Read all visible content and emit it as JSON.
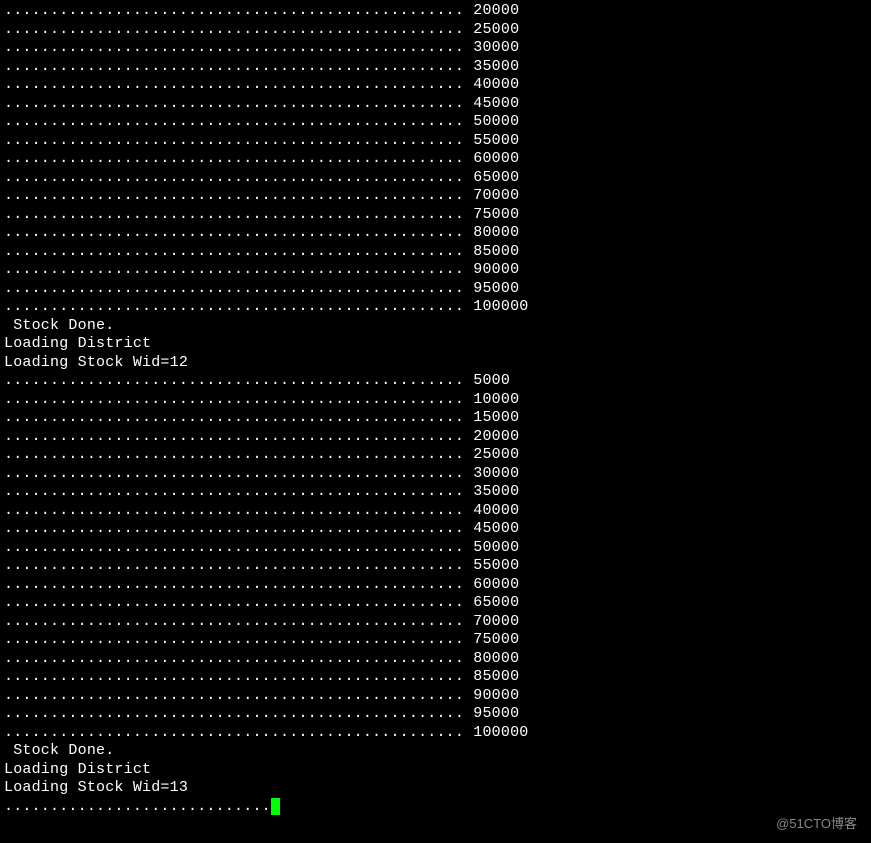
{
  "terminal": {
    "dots": "..................................................",
    "partial_dots": ".............................",
    "block1_values": [
      "20000",
      "25000",
      "30000",
      "35000",
      "40000",
      "45000",
      "50000",
      "55000",
      "60000",
      "65000",
      "70000",
      "75000",
      "80000",
      "85000",
      "90000",
      "95000",
      "100000"
    ],
    "stock_done": " Stock Done.",
    "loading_district": "Loading District",
    "loading_stock_12": "Loading Stock Wid=12",
    "block2_values": [
      "5000",
      "10000",
      "15000",
      "20000",
      "25000",
      "30000",
      "35000",
      "40000",
      "45000",
      "50000",
      "55000",
      "60000",
      "65000",
      "70000",
      "75000",
      "80000",
      "85000",
      "90000",
      "95000",
      "100000"
    ],
    "loading_stock_13": "Loading Stock Wid=13"
  },
  "watermark": "@51CTO博客",
  "colors": {
    "bg": "#000000",
    "fg": "#ffffff",
    "cursor": "#00ff00",
    "watermark": "#888888"
  }
}
